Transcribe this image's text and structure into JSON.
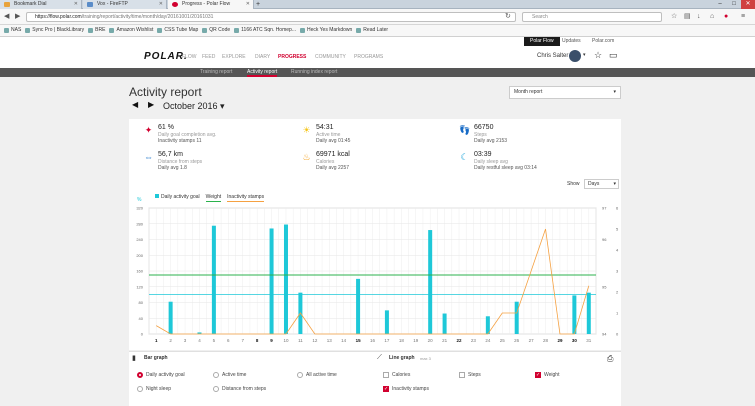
{
  "browser": {
    "tabs": [
      {
        "title": "Bookmark Dial",
        "color": "#e8a33c"
      },
      {
        "title": "Vox - FireFTP",
        "color": "#5a8cc8"
      },
      {
        "title": "Progress - Polar Flow",
        "color": "#d1002f"
      }
    ],
    "new_tab": "+",
    "url_host": "https://flow.polar.com",
    "url_path": "/training/report/activity/time/month/day/20161001/20161031",
    "search_placeholder": "Search",
    "bookmarks": [
      "NAS",
      "Sync Pro | BlackLibrary",
      "BRE",
      "Amazon Wishlist",
      "CSS Tube Map",
      "QR Code",
      "1166 ATC Sqn. Homep...",
      "Heck Yes Markdown",
      "Read Later"
    ]
  },
  "top_links": [
    "Polar Flow",
    "Updates",
    "Polar.com"
  ],
  "header": {
    "logo": "POLAR.",
    "nav": [
      "FLOW",
      "FEED",
      "EXPLORE",
      "DIARY",
      "PROGRESS",
      "COMMUNITY",
      "PROGRAMS"
    ],
    "active_nav": "PROGRESS",
    "username": "Chris Salter"
  },
  "subnav": {
    "items": [
      "Training report",
      "Activity report",
      "Running index report"
    ],
    "active": "Activity report"
  },
  "page": {
    "title": "Activity report",
    "month": "October 2016",
    "period_select": "Month report"
  },
  "summary": [
    {
      "value": "61 %",
      "label": "Daily goal completion avg.",
      "sub": "Inactivity stamps 11",
      "icon": "goal-icon",
      "color": "#d1002f"
    },
    {
      "value": "54:31",
      "label": "Active time",
      "sub": "Daily avg 01:45",
      "icon": "active-time-icon",
      "color": "#f5c518"
    },
    {
      "value": "66750",
      "label": "Steps",
      "sub": "Daily avg 2153",
      "icon": "steps-icon",
      "color": "#888888"
    },
    {
      "value": "56,7 km",
      "label": "Distance from steps",
      "sub": "Daily avg 1.8",
      "icon": "distance-icon",
      "color": "#1a73c8"
    },
    {
      "value": "69971 kcal",
      "label": "Calories",
      "sub": "Daily avg 2257",
      "icon": "calories-icon",
      "color": "#f39c12"
    },
    {
      "value": "03:39",
      "label": "Daily sleep avg",
      "sub": "Daily restful sleep avg 03:14",
      "icon": "sleep-icon",
      "color": "#1aa3d9"
    }
  ],
  "show": {
    "label": "Show",
    "value": "Days"
  },
  "chart_data": {
    "type": "bar",
    "legend": [
      {
        "name": "Daily activity goal",
        "color": "#1ec8d8"
      },
      {
        "name": "Weight",
        "color": "#2bb24c"
      },
      {
        "name": "Inactivity stamps",
        "color": "#f5a142"
      }
    ],
    "x": [
      1,
      2,
      3,
      4,
      5,
      6,
      7,
      8,
      9,
      10,
      11,
      12,
      13,
      14,
      15,
      16,
      17,
      18,
      19,
      20,
      21,
      22,
      23,
      24,
      25,
      26,
      27,
      28,
      29,
      30,
      31
    ],
    "bold_days": [
      1,
      8,
      9,
      15,
      22,
      29,
      30
    ],
    "left_axis_label": "%",
    "left_ticks": [
      0,
      40,
      80,
      120,
      160,
      200,
      240,
      280,
      320
    ],
    "ylim": [
      0,
      320
    ],
    "right_outer_ticks": [
      "94",
      "",
      "",
      "95",
      "",
      "",
      "96",
      "",
      "97"
    ],
    "right_inner_ticks": [
      "0",
      "1",
      "2",
      "3",
      "4",
      "5",
      "6"
    ],
    "inner_max": 6,
    "series": [
      {
        "name": "Daily activity goal",
        "values": [
          0,
          82,
          0,
          4,
          275,
          0,
          0,
          0,
          268,
          278,
          105,
          0,
          0,
          0,
          140,
          0,
          60,
          0,
          0,
          264,
          52,
          0,
          0,
          45,
          0,
          82,
          0,
          0,
          0,
          98,
          105
        ]
      },
      {
        "name": "Weight (bars axis)",
        "values": [
          0,
          0,
          0,
          0,
          0,
          0,
          0,
          0,
          0,
          0,
          0,
          0,
          0,
          0,
          0,
          0,
          0,
          0,
          0,
          0,
          0,
          0,
          0,
          0,
          0,
          0,
          0,
          0,
          0,
          0,
          0
        ]
      },
      {
        "name": "Inactivity stamps",
        "values": [
          0.4,
          0,
          0,
          0,
          0,
          0,
          0,
          0,
          0,
          0,
          1,
          0,
          0,
          0,
          0,
          0,
          0,
          0,
          0,
          0,
          0,
          0,
          0,
          0,
          1,
          1,
          3,
          5,
          0,
          0,
          2.3
        ]
      }
    ],
    "weight_line": 150,
    "teal_line": 100
  },
  "controls": {
    "bar_title": "Bar graph",
    "line_title": "Line graph",
    "line_note": "max 3",
    "bar_options": [
      {
        "label": "Daily activity goal",
        "on": true
      },
      {
        "label": "Active time",
        "on": false
      },
      {
        "label": "All active time",
        "on": false
      },
      {
        "label": "Night sleep",
        "on": false
      },
      {
        "label": "Distance from steps",
        "on": false
      }
    ],
    "line_options": [
      {
        "label": "Calories",
        "on": false
      },
      {
        "label": "Steps",
        "on": false
      },
      {
        "label": "Weight",
        "on": true
      },
      {
        "label": "Inactivity stamps",
        "on": true
      }
    ]
  }
}
